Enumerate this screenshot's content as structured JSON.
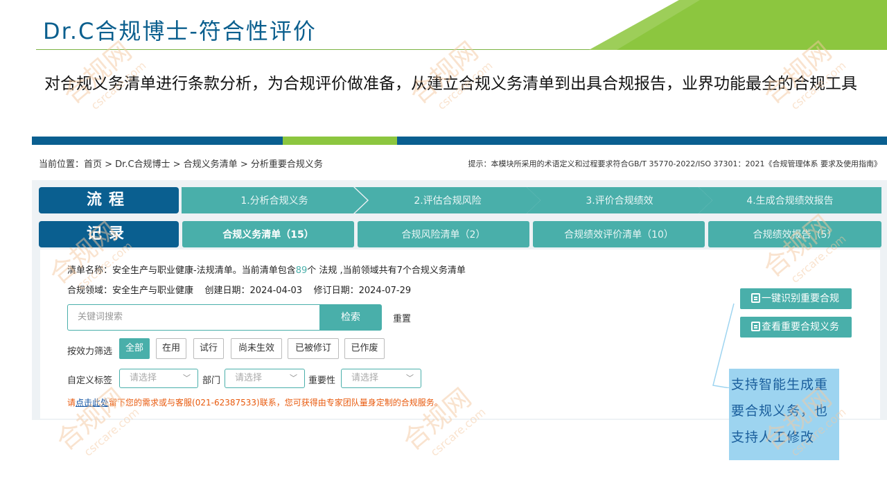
{
  "slide": {
    "title": "Dr.C合规博士-符合性评价",
    "subtitle": "对合规义务清单进行条款分析，为合规评价做准备，从建立合规义务清单到出具合规报告，业界功能最全的合规工具"
  },
  "breadcrumb": "当前位置：首页 > Dr.C合规博士 > 合规义务清单 > 分析重要合规义务",
  "hint": "提示：本模块所采用的术语定义和过程要求符合GB/T 35770-2022/ISO 37301：2021《合规管理体系 要求及使用指南》",
  "flow": {
    "label": "流程",
    "steps": [
      "1.分析合规义务",
      "2.评估合规风险",
      "3.评价合规绩效",
      "4.生成合规绩效报告"
    ]
  },
  "record": {
    "label": "记录",
    "tabs": [
      "合规义务清单（15）",
      "合规风险清单（2）",
      "合规绩效评价清单（10）",
      "合规绩效报告（5）"
    ]
  },
  "info": {
    "list_name_prefix": "清单名称：安全生产与职业健康-法规清单。当前清单包含",
    "list_count": "89",
    "list_name_suffix": "个 法规 ,当前领域共有7个合规义务清单",
    "domain_line": "合规领域：安全生产与职业健康    创建日期：2024-04-03    修订日期：2024-07-29"
  },
  "search": {
    "placeholder": "关键词搜索",
    "button": "检索",
    "reset": "重置"
  },
  "filter": {
    "label": "按效力筛选",
    "chips": [
      "全部",
      "在用",
      "试行",
      "尚未生效",
      "已被修订",
      "已作废"
    ]
  },
  "selects": {
    "tag_label": "自定义标签",
    "dept_label": "部门",
    "importance_label": "重要性",
    "placeholder": "请选择"
  },
  "contact": {
    "prefix": "请",
    "link": "点击此处",
    "suffix": "留下您的需求或与客服(021-62387533)联系，您可获得由专家团队量身定制的合规服务。"
  },
  "actions": {
    "identify": "一键识别重要合规",
    "view": "查看重要合规义务"
  },
  "callout": "支持智能生成重要合规义务，也支持人工修改",
  "watermark": {
    "cn": "合规网",
    "en": "csrcare.com"
  },
  "colors": {
    "brand_blue": "#0a5f90",
    "teal": "#49afaa",
    "green": "#8cc63f",
    "callout_bg": "#9dd4f0",
    "contact_orange": "#e8590c"
  }
}
